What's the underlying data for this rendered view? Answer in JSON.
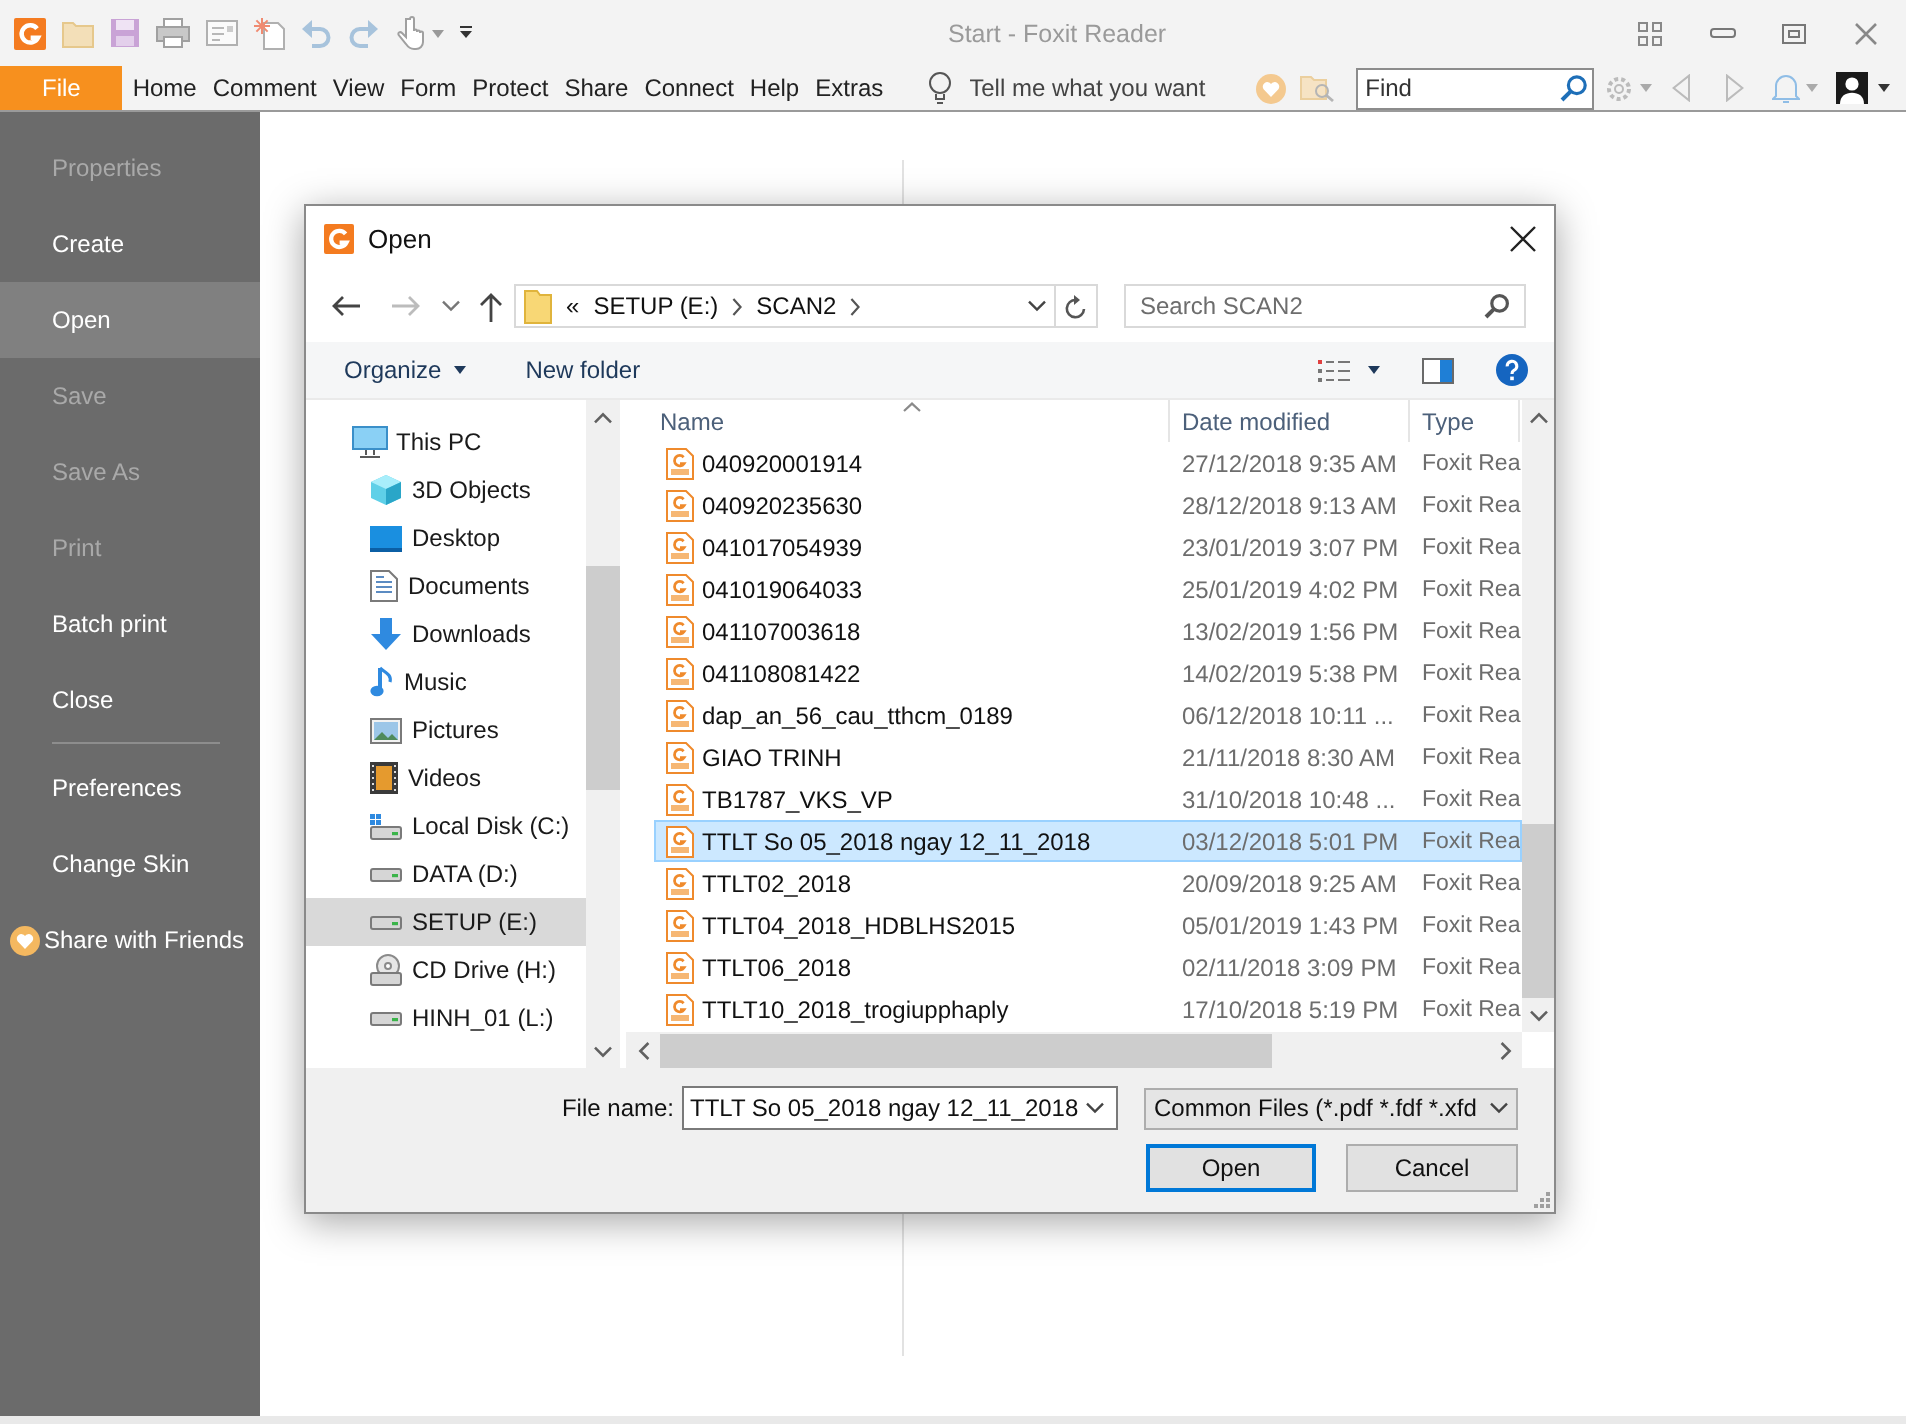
{
  "app": {
    "title": "Start - Foxit Reader"
  },
  "menu_bar": {
    "items": [
      {
        "label": "File",
        "selected": true
      },
      {
        "label": "Home",
        "selected": false
      },
      {
        "label": "Comment",
        "selected": false
      },
      {
        "label": "View",
        "selected": false
      },
      {
        "label": "Form",
        "selected": false
      },
      {
        "label": "Protect",
        "selected": false
      },
      {
        "label": "Share",
        "selected": false
      },
      {
        "label": "Connect",
        "selected": false
      },
      {
        "label": "Help",
        "selected": false
      },
      {
        "label": "Extras",
        "selected": false
      }
    ],
    "tell_me": {
      "placeholder": "Tell me what you want"
    },
    "find": {
      "placeholder": "Find"
    }
  },
  "sidebar": {
    "groups": [
      {
        "items": [
          {
            "label": "Properties",
            "kind": "plain",
            "disabled": true,
            "selected": false
          },
          {
            "label": "Create",
            "kind": "plain",
            "disabled": false,
            "selected": false
          },
          {
            "label": "Open",
            "kind": "plain",
            "disabled": false,
            "selected": true
          },
          {
            "label": "Save",
            "kind": "plain",
            "disabled": true,
            "selected": false
          },
          {
            "label": "Save As",
            "kind": "plain",
            "disabled": true,
            "selected": false
          },
          {
            "label": "Print",
            "kind": "plain",
            "disabled": true,
            "selected": false
          },
          {
            "label": "Batch print",
            "kind": "plain",
            "disabled": false,
            "selected": false
          },
          {
            "label": "Close",
            "kind": "plain",
            "disabled": false,
            "selected": false
          }
        ]
      },
      {
        "items": [
          {
            "label": "Preferences",
            "kind": "plain",
            "disabled": false,
            "selected": false
          },
          {
            "label": "Change Skin",
            "kind": "plain",
            "disabled": false,
            "selected": false
          },
          {
            "label": "Share with Friends",
            "kind": "share",
            "disabled": false,
            "selected": false
          }
        ]
      }
    ]
  },
  "dialog": {
    "title": "Open",
    "address": {
      "overflow_mark": "«",
      "segments": [
        "SETUP (E:)",
        "SCAN2"
      ]
    },
    "search": {
      "placeholder": "Search SCAN2"
    },
    "toolbar": {
      "organize": "Organize",
      "new_folder": "New folder"
    },
    "nav_pane": {
      "items": [
        {
          "label": "This PC",
          "kind": "pc",
          "selected": false,
          "children": [
            {
              "label": "3D Objects",
              "kind": "objects3d",
              "selected": false
            },
            {
              "label": "Desktop",
              "kind": "desktop",
              "selected": false
            },
            {
              "label": "Documents",
              "kind": "documents",
              "selected": false
            },
            {
              "label": "Downloads",
              "kind": "downloads",
              "selected": false
            },
            {
              "label": "Music",
              "kind": "music",
              "selected": false
            },
            {
              "label": "Pictures",
              "kind": "pictures",
              "selected": false
            },
            {
              "label": "Videos",
              "kind": "videos",
              "selected": false
            },
            {
              "label": "Local Disk (C:)",
              "kind": "system_drive",
              "selected": false
            },
            {
              "label": "DATA (D:)",
              "kind": "drive",
              "selected": false
            },
            {
              "label": "SETUP (E:)",
              "kind": "drive",
              "selected": true
            },
            {
              "label": "CD Drive (H:)",
              "kind": "cd_drive",
              "selected": false
            },
            {
              "label": "HINH_01 (L:)",
              "kind": "drive",
              "selected": false
            }
          ]
        }
      ]
    },
    "file_list": {
      "columns": [
        {
          "label": "Name",
          "sorted": true
        },
        {
          "label": "Date modified",
          "sorted": false
        },
        {
          "label": "Type",
          "sorted": false
        }
      ],
      "rows": [
        {
          "name": "040920001914",
          "date": "27/12/2018 9:35 AM",
          "type": "Foxit Rea",
          "selected": false
        },
        {
          "name": "040920235630",
          "date": "28/12/2018 9:13 AM",
          "type": "Foxit Rea",
          "selected": false
        },
        {
          "name": "041017054939",
          "date": "23/01/2019 3:07 PM",
          "type": "Foxit Rea",
          "selected": false
        },
        {
          "name": "041019064033",
          "date": "25/01/2019 4:02 PM",
          "type": "Foxit Rea",
          "selected": false
        },
        {
          "name": "041107003618",
          "date": "13/02/2019 1:56 PM",
          "type": "Foxit Rea",
          "selected": false
        },
        {
          "name": "041108081422",
          "date": "14/02/2019 5:38 PM",
          "type": "Foxit Rea",
          "selected": false
        },
        {
          "name": "dap_an_56_cau_tthcm_0189",
          "date": "06/12/2018 10:11 ...",
          "type": "Foxit Rea",
          "selected": false
        },
        {
          "name": "GIAO TRINH",
          "date": "21/11/2018 8:30 AM",
          "type": "Foxit Rea",
          "selected": false
        },
        {
          "name": "TB1787_VKS_VP",
          "date": "31/10/2018 10:48 ...",
          "type": "Foxit Rea",
          "selected": false
        },
        {
          "name": "TTLT So 05_2018 ngay 12_11_2018",
          "date": "03/12/2018 5:01 PM",
          "type": "Foxit Rea",
          "selected": true
        },
        {
          "name": "TTLT02_2018",
          "date": "20/09/2018 9:25 AM",
          "type": "Foxit Rea",
          "selected": false
        },
        {
          "name": "TTLT04_2018_HDBLHS2015",
          "date": "05/01/2019 1:43 PM",
          "type": "Foxit Rea",
          "selected": false
        },
        {
          "name": "TTLT06_2018",
          "date": "02/11/2018 3:09 PM",
          "type": "Foxit Rea",
          "selected": false
        },
        {
          "name": "TTLT10_2018_trogiupphaply",
          "date": "17/10/2018 5:19 PM",
          "type": "Foxit Rea",
          "selected": false
        }
      ]
    },
    "file_name": {
      "label": "File name:",
      "value": "TTLT So 05_2018 ngay 12_11_2018"
    },
    "file_type": {
      "value": "Common Files (*.pdf *.fdf *.xfd"
    },
    "buttons": [
      {
        "label": "Open",
        "kind": "default"
      },
      {
        "label": "Cancel",
        "kind": "normal"
      }
    ]
  }
}
